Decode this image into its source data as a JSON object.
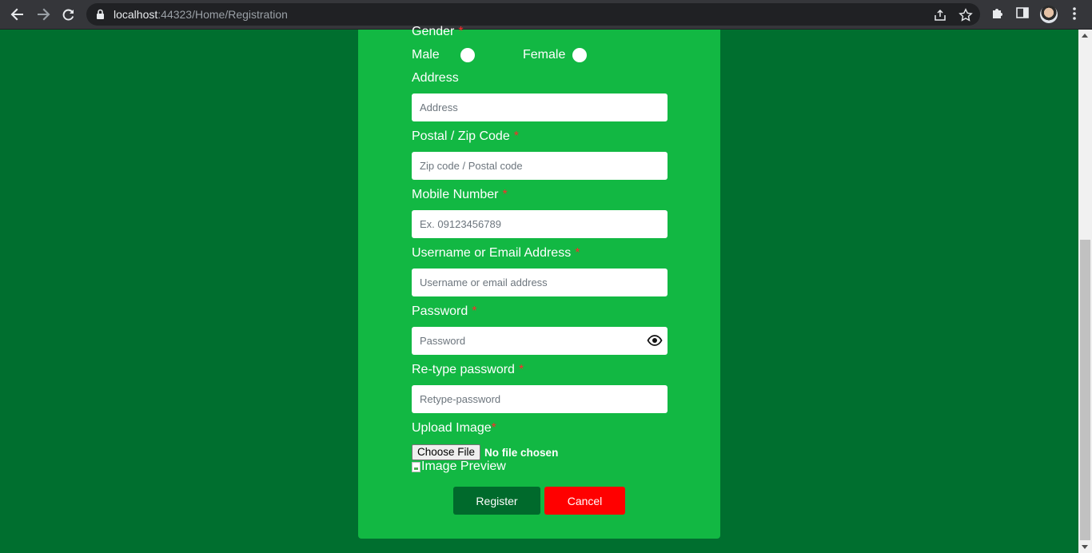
{
  "browser": {
    "url_host": "localhost",
    "url_path": ":44323/Home/Registration"
  },
  "form": {
    "gender": {
      "label": "Gender",
      "male_label": "Male",
      "female_label": "Female"
    },
    "address": {
      "label": "Address",
      "placeholder": "Address"
    },
    "postal": {
      "label": "Postal / Zip Code",
      "placeholder": "Zip code / Postal code"
    },
    "mobile": {
      "label": "Mobile Number",
      "placeholder": "Ex. 09123456789"
    },
    "username": {
      "label": "Username or Email Address",
      "placeholder": "Username or email address"
    },
    "password": {
      "label": "Password",
      "placeholder": "Password"
    },
    "retype": {
      "label": "Re-type password",
      "placeholder": "Retype-password"
    },
    "upload": {
      "label": "Upload Image",
      "button": "Choose File",
      "status": "No file chosen",
      "preview_alt": "Image Preview"
    },
    "required_mark": "*",
    "register_button": "Register",
    "cancel_button": "Cancel"
  },
  "colors": {
    "page_bg": "#006f2f",
    "card_bg": "#12b843",
    "register_bg": "#006a2c",
    "cancel_bg": "#ff0000",
    "required": "#ff2a2a"
  }
}
